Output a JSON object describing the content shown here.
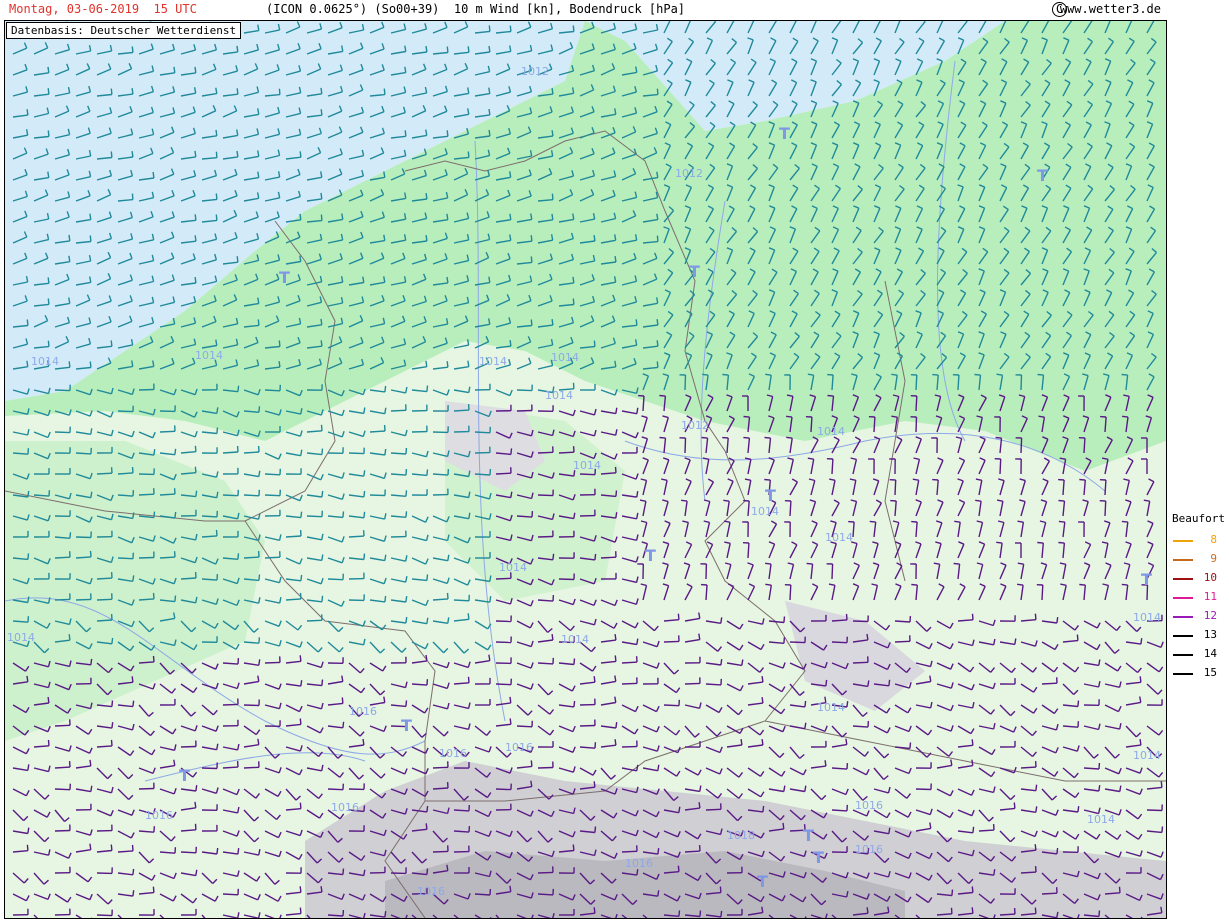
{
  "header": {
    "date": "Montag, 03-06-2019  15 UTC",
    "model": "(ICON 0.0625°) (So00+39)  10 m Wind [kn], Bodendruck [hPa]",
    "copyright_symbol": "C",
    "site": "www.wetter3.de"
  },
  "source": "Datenbasis: Deutscher Wetterdienst",
  "legend": {
    "title": "Beaufort",
    "items": [
      {
        "value": "8",
        "color": "#f0a20a"
      },
      {
        "value": "9",
        "color": "#c86a1e"
      },
      {
        "value": "10",
        "color": "#a01010"
      },
      {
        "value": "11",
        "color": "#e01a96"
      },
      {
        "value": "12",
        "color": "#9a1ab8"
      },
      {
        "value": "13",
        "color": "#000000"
      },
      {
        "value": "14",
        "color": "#000000"
      },
      {
        "value": "15",
        "color": "#000000"
      }
    ]
  },
  "map": {
    "pressure_labels": [
      "1014",
      "1014",
      "1014",
      "1014",
      "1014",
      "1014",
      "1014",
      "1014",
      "1014",
      "1014",
      "1012",
      "1012",
      "1012",
      "1014",
      "1014",
      "1014",
      "1016",
      "1016",
      "1016",
      "1016",
      "1016",
      "1018",
      "1016",
      "1016",
      "1014",
      "1014",
      "1014",
      "1016",
      "1016"
    ],
    "low_marker": "T",
    "colors": {
      "sea": "#d6ecfa",
      "land_green": "#c4f2c6",
      "land_light": "#e8f7e4",
      "mountain": "#c8c8cc",
      "barb_teal": "#208a9a",
      "barb_purple": "#5a1a86",
      "isobar": "#8ea8e8"
    }
  }
}
